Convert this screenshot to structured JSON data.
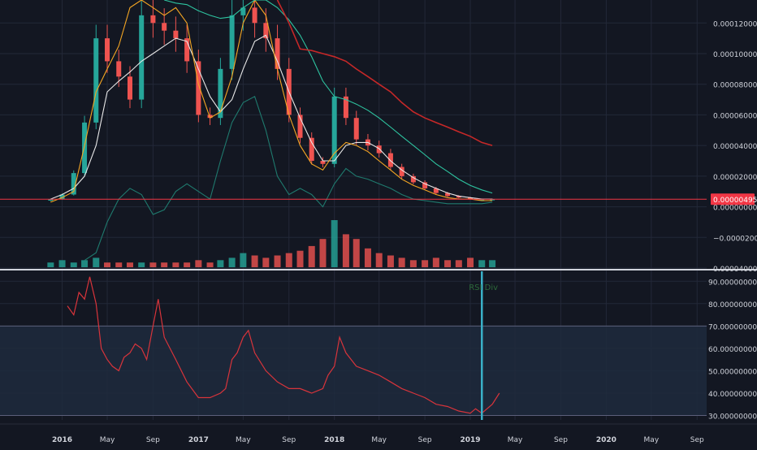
{
  "colors": {
    "background": "#131722",
    "grid": "#232838",
    "axis_text": "#d1d4dc",
    "rsi_line": "#d8343b",
    "rsi_band": "#1e2a3d",
    "price_marker": "#f23645",
    "bull": "#26a69a",
    "bear": "#ef5350",
    "ma_white": "#e8e8e8",
    "ma_orange": "#f5a623",
    "ma_green": "#2ec4a0",
    "ma_red": "#c62828",
    "bb_teal": "#1f7a6e",
    "highlight_bar": "#3ab0c8"
  },
  "price_marker_label": "0.00000495",
  "rsi_marker_label": "RSI Div",
  "chart_data": [
    {
      "type": "line",
      "panel": "price",
      "ylim": [
        -4e-05,
        0.000135
      ],
      "y_ticks": [
        {
          "value": 0.00012,
          "label": "0.00012000"
        },
        {
          "value": 0.0001,
          "label": "0.00010000"
        },
        {
          "value": 8e-05,
          "label": "0.00008000"
        },
        {
          "value": 6e-05,
          "label": "0.00006000"
        },
        {
          "value": 4e-05,
          "label": "0.00004000"
        },
        {
          "value": 2e-05,
          "label": "0.00002000"
        },
        {
          "value": 0.0,
          "label": "0.00000000"
        },
        {
          "value": -2e-05,
          "label": "−0.00002000"
        },
        {
          "value": -4e-05,
          "label": "0.00004000"
        }
      ],
      "last_price": 4.95e-06,
      "x": [
        "2015-12-01",
        "2016-01-01",
        "2016-02-01",
        "2016-03-01",
        "2016-04-01",
        "2016-05-01",
        "2016-06-01",
        "2016-07-01",
        "2016-08-01",
        "2016-09-01",
        "2016-10-01",
        "2016-11-01",
        "2016-12-01",
        "2017-01-01",
        "2017-02-01",
        "2017-03-01",
        "2017-04-01",
        "2017-05-01",
        "2017-06-01",
        "2017-07-01",
        "2017-08-01",
        "2017-09-01",
        "2017-10-01",
        "2017-11-01",
        "2017-12-01",
        "2018-01-01",
        "2018-02-01",
        "2018-03-01",
        "2018-04-01",
        "2018-05-01",
        "2018-06-01",
        "2018-07-01",
        "2018-08-01",
        "2018-09-01",
        "2018-10-01",
        "2018-11-01",
        "2018-12-01",
        "2019-01-01",
        "2019-02-01",
        "2019-03-01"
      ],
      "series": [
        {
          "color_key": "ma_white",
          "values": [
            5e-06,
            8e-06,
            1.2e-05,
            2e-05,
            4e-05,
            7.5e-05,
            8.2e-05,
            8.8e-05,
            9.5e-05,
            0.0001,
            0.000105,
            0.00011,
            0.000108,
            9e-05,
            7.2e-05,
            6.2e-05,
            7e-05,
            9e-05,
            0.000108,
            0.000112,
            9.5e-05,
            7.5e-05,
            5.8e-05,
            4.2e-05,
            3e-05,
            3e-05,
            4e-05,
            4.2e-05,
            4.2e-05,
            3.8e-05,
            3e-05,
            2.4e-05,
            1.9e-05,
            1.5e-05,
            1.2e-05,
            9e-06,
            7e-06,
            6e-06,
            5e-06,
            5e-06
          ]
        },
        {
          "color_key": "ma_orange",
          "values": [
            3e-06,
            6e-06,
            1e-05,
            4e-05,
            7.5e-05,
            9e-05,
            0.000105,
            0.00013,
            0.000135,
            0.00013,
            0.000125,
            0.00013,
            0.00012,
            8e-05,
            5.8e-05,
            6.2e-05,
            8.5e-05,
            0.00012,
            0.000135,
            0.000125,
            9e-05,
            6e-05,
            4e-05,
            2.8e-05,
            2.4e-05,
            3.5e-05,
            4.2e-05,
            4e-05,
            3.6e-05,
            3e-05,
            2.4e-05,
            1.8e-05,
            1.4e-05,
            1.1e-05,
            8e-06,
            6e-06,
            5e-06,
            5e-06,
            4e-06,
            4e-06
          ]
        },
        {
          "color_key": "ma_green",
          "values": [
            null,
            null,
            null,
            null,
            null,
            null,
            null,
            null,
            null,
            null,
            0.000135,
            0.000133,
            0.000132,
            0.000128,
            0.000125,
            0.000123,
            0.000124,
            0.00013,
            0.000135,
            0.000135,
            0.00013,
            0.000122,
            0.000112,
            9.8e-05,
            8.2e-05,
            7.2e-05,
            7e-05,
            6.7e-05,
            6.3e-05,
            5.8e-05,
            5.2e-05,
            4.6e-05,
            4e-05,
            3.4e-05,
            2.8e-05,
            2.3e-05,
            1.8e-05,
            1.4e-05,
            1.1e-05,
            9e-06
          ]
        },
        {
          "color_key": "ma_red",
          "values": [
            null,
            null,
            null,
            null,
            null,
            null,
            null,
            null,
            null,
            null,
            null,
            null,
            null,
            null,
            null,
            null,
            null,
            null,
            null,
            null,
            0.000135,
            0.00012,
            0.000103,
            0.000102,
            0.0001,
            9.8e-05,
            9.5e-05,
            9e-05,
            8.5e-05,
            8e-05,
            7.5e-05,
            6.8e-05,
            6.2e-05,
            5.8e-05,
            5.5e-05,
            5.2e-05,
            4.9e-05,
            4.6e-05,
            4.2e-05,
            4e-05
          ]
        },
        {
          "color_key": "bb_teal",
          "values": [
            null,
            null,
            null,
            -3.5e-05,
            -3e-05,
            -1e-05,
            5e-06,
            1.2e-05,
            8e-06,
            -5e-06,
            -2e-06,
            1e-05,
            1.5e-05,
            1e-05,
            5e-06,
            3e-05,
            5.5e-05,
            6.8e-05,
            7.2e-05,
            5e-05,
            2e-05,
            8e-06,
            1.2e-05,
            8e-06,
            0.0,
            1.5e-05,
            2.5e-05,
            2e-05,
            1.8e-05,
            1.5e-05,
            1.2e-05,
            8e-06,
            5e-06,
            4e-06,
            3e-06,
            2e-06,
            2e-06,
            2e-06,
            2e-06,
            3e-06
          ]
        }
      ],
      "candles": [
        5e-06,
        8e-06,
        2.2e-05,
        5.5e-05,
        0.00011,
        9.5e-05,
        8.5e-05,
        7e-05,
        0.000125,
        0.00012,
        0.000115,
        0.00011,
        9.5e-05,
        6e-05,
        5.8e-05,
        9e-05,
        0.000125,
        0.00013,
        0.00012,
        0.00011,
        9e-05,
        6e-05,
        4.5e-05,
        3e-05,
        2.8e-05,
        7.2e-05,
        5.8e-05,
        4.4e-05,
        4e-05,
        3.5e-05,
        2.6e-05,
        2e-05,
        1.6e-05,
        1.2e-05,
        9e-06,
        7e-06,
        6e-06,
        5e-06,
        5e-06,
        5e-06
      ],
      "volume": [
        0.1,
        0.15,
        0.1,
        0.15,
        0.2,
        0.1,
        0.1,
        0.1,
        0.1,
        0.1,
        0.1,
        0.1,
        0.1,
        0.15,
        0.1,
        0.15,
        0.2,
        0.3,
        0.25,
        0.2,
        0.25,
        0.3,
        0.35,
        0.45,
        0.6,
        1.0,
        0.7,
        0.6,
        0.4,
        0.3,
        0.25,
        0.2,
        0.15,
        0.15,
        0.2,
        0.15,
        0.15,
        0.2,
        0.15,
        0.15
      ]
    },
    {
      "type": "line",
      "panel": "rsi",
      "ylim": [
        28,
        93
      ],
      "y_ticks": [
        {
          "value": 90,
          "label": "90.00000000"
        },
        {
          "value": 80,
          "label": "80.00000000"
        },
        {
          "value": 70,
          "label": "70.00000000"
        },
        {
          "value": 60,
          "label": "60.00000000"
        },
        {
          "value": 50,
          "label": "50.00000000"
        },
        {
          "value": 40,
          "label": "40.00000000"
        },
        {
          "value": 30,
          "label": "30.00000000"
        }
      ],
      "band": [
        30,
        70
      ],
      "x": [
        "2016-01-15",
        "2016-02-01",
        "2016-02-15",
        "2016-03-01",
        "2016-03-15",
        "2016-04-01",
        "2016-04-15",
        "2016-05-01",
        "2016-05-15",
        "2016-06-01",
        "2016-06-15",
        "2016-07-01",
        "2016-07-15",
        "2016-08-01",
        "2016-08-15",
        "2016-09-01",
        "2016-09-15",
        "2016-10-01",
        "2016-11-01",
        "2016-12-01",
        "2017-01-01",
        "2017-02-01",
        "2017-03-01",
        "2017-03-15",
        "2017-04-01",
        "2017-04-15",
        "2017-05-01",
        "2017-05-15",
        "2017-06-01",
        "2017-07-01",
        "2017-08-01",
        "2017-09-01",
        "2017-10-01",
        "2017-11-01",
        "2017-12-01",
        "2017-12-15",
        "2018-01-01",
        "2018-01-15",
        "2018-02-01",
        "2018-02-15",
        "2018-03-01",
        "2018-04-01",
        "2018-05-01",
        "2018-06-01",
        "2018-07-01",
        "2018-08-01",
        "2018-09-01",
        "2018-10-01",
        "2018-11-01",
        "2018-12-01",
        "2019-01-01",
        "2019-01-15",
        "2019-02-01",
        "2019-03-01",
        "2019-03-20"
      ],
      "values": [
        79,
        75,
        85,
        82,
        92,
        80,
        60,
        55,
        52,
        50,
        56,
        58,
        62,
        60,
        55,
        70,
        82,
        65,
        55,
        45,
        38,
        38,
        40,
        42,
        55,
        58,
        65,
        68,
        58,
        50,
        45,
        42,
        42,
        40,
        42,
        48,
        52,
        65,
        58,
        55,
        52,
        50,
        48,
        45,
        42,
        40,
        38,
        35,
        34,
        32,
        31,
        33,
        31,
        35,
        40
      ]
    }
  ],
  "x_ticks": [
    {
      "date": "2016-01-01",
      "label": "2016",
      "bold": true
    },
    {
      "date": "2016-05-01",
      "label": "May",
      "bold": false
    },
    {
      "date": "2016-09-01",
      "label": "Sep",
      "bold": false
    },
    {
      "date": "2017-01-01",
      "label": "2017",
      "bold": true
    },
    {
      "date": "2017-05-01",
      "label": "May",
      "bold": false
    },
    {
      "date": "2017-09-01",
      "label": "Sep",
      "bold": false
    },
    {
      "date": "2018-01-01",
      "label": "2018",
      "bold": true
    },
    {
      "date": "2018-05-01",
      "label": "May",
      "bold": false
    },
    {
      "date": "2018-09-01",
      "label": "Sep",
      "bold": false
    },
    {
      "date": "2019-01-01",
      "label": "2019",
      "bold": true
    },
    {
      "date": "2019-05-01",
      "label": "May",
      "bold": false
    },
    {
      "date": "2019-09-01",
      "label": "Sep",
      "bold": false
    },
    {
      "date": "2020-01-01",
      "label": "2020",
      "bold": true
    },
    {
      "date": "2020-05-01",
      "label": "May",
      "bold": false
    },
    {
      "date": "2020-09-01",
      "label": "Sep",
      "bold": false
    }
  ],
  "rsi_marker_date": "2019-02-01"
}
